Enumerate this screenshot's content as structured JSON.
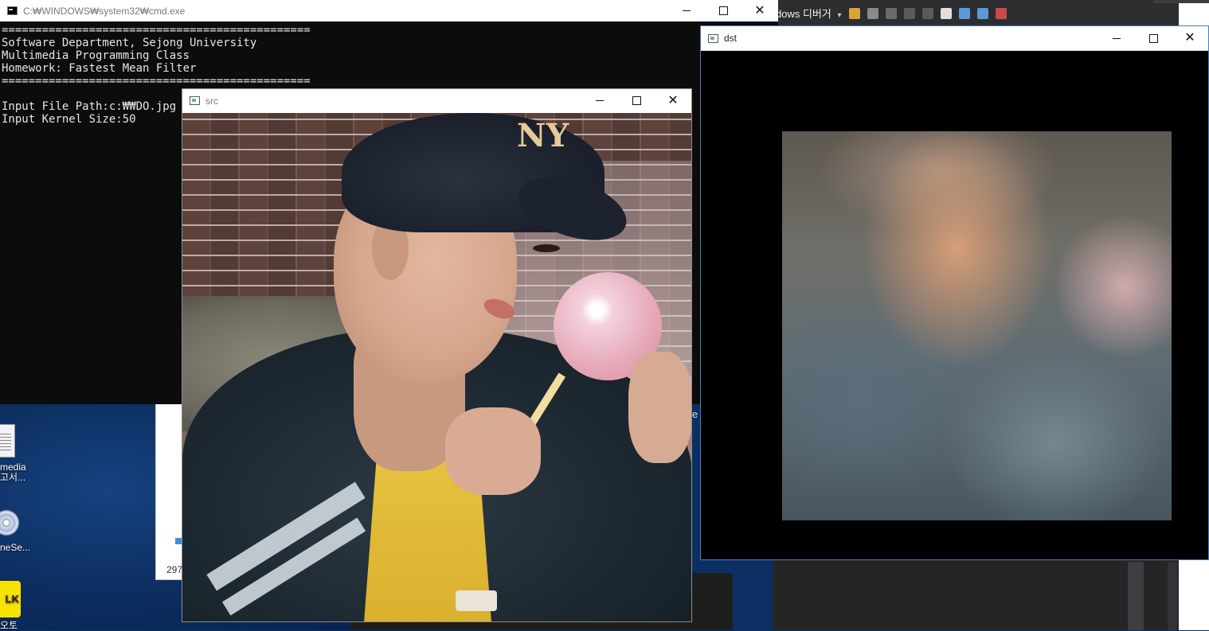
{
  "desktop": {
    "icons": [
      {
        "label_line1": "media",
        "label_line2": "고서..."
      },
      {
        "label_line1": "neSe..."
      },
      {
        "label_line1": "LK",
        "label_line2": "오토"
      }
    ],
    "explorer_partial_text": "297"
  },
  "visual_studio": {
    "toolbar_label": "dows 디버거",
    "dropdown_glyph": "▾"
  },
  "cmd_window": {
    "title": "C:₩WINDOWS₩system32₩cmd.exe",
    "lines": [
      "==============================================",
      "Software Department, Sejong University",
      "Multimedia Programming Class",
      "Homework: Fastest Mean Filter",
      "==============================================",
      "",
      "Input File Path:c:₩₩DO.jpg",
      "Input Kernel Size:50"
    ]
  },
  "src_window": {
    "title": "src",
    "image_caption": "Photo: man in navy NY baseball cap holding a pink lollipop in front of a brick wall",
    "cap_logo": "NY"
  },
  "dst_window": {
    "title": "dst",
    "image_caption": "Mean-filtered (heavily blurred) version of the source photo"
  },
  "peek_text": "e",
  "window_controls": {
    "minimize": "minimize",
    "maximize": "maximize",
    "close": "✕"
  },
  "colors": {
    "desktop_bg": "#0b2f63",
    "console_bg": "#0c0c0c",
    "console_fg": "#e6e6e6",
    "vs_bg": "#2d2d30",
    "dst_border": "#4a7fb5"
  }
}
